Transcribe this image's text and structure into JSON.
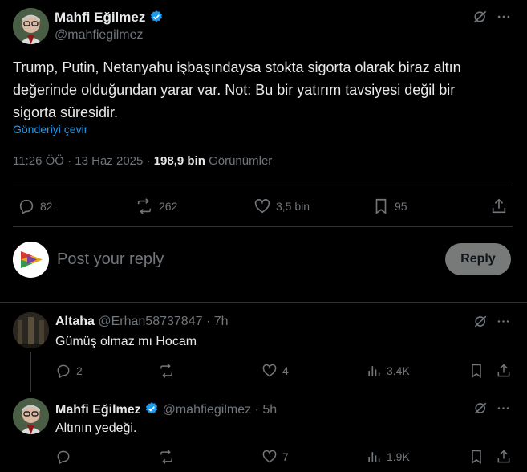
{
  "main_tweet": {
    "author_name": "Mahfi Eğilmez",
    "author_handle": "@mahfiegilmez",
    "text": "Trump, Putin, Netanyahu işbaşındaysa stokta sigorta olarak biraz altın değerinde olduğundan yarar var. Not: Bu bir yatırım tavsiyesi değil bir sigorta süresidir.",
    "translate_label": "Gönderiyi çevir",
    "time": "11:26 ÖÖ",
    "date": "13 Haz 2025",
    "separator": "·",
    "views_count": "198,9 bin",
    "views_label": "Görünümler",
    "stats": {
      "replies": "82",
      "reposts": "262",
      "likes": "3,5 bin",
      "bookmarks": "95"
    }
  },
  "composer": {
    "placeholder": "Post your reply",
    "reply_button": "Reply"
  },
  "replies": [
    {
      "author_name": "Altaha",
      "author_handle": "@Erhan58737847",
      "time": "· 7h",
      "text": "Gümüş olmaz mı Hocam",
      "stats": {
        "replies": "2",
        "reposts": "",
        "likes": "4",
        "views": "3.4K"
      }
    },
    {
      "author_name": "Mahfi Eğilmez",
      "author_handle": "@mahfiegilmez",
      "time": "· 5h",
      "text": "Altının yedeği.",
      "stats": {
        "replies": "",
        "reposts": "",
        "likes": "7",
        "views": "1.9K"
      }
    }
  ],
  "colors": {
    "background": "#000000",
    "text": "#e7e9ea",
    "muted": "#71767b",
    "link": "#1d9bf0",
    "verified": "#1d9bf0",
    "divider": "#2f3336"
  },
  "icons": [
    "grok-icon",
    "more-icon",
    "verified-icon",
    "reply-icon",
    "repost-icon",
    "like-icon",
    "bookmark-icon",
    "share-icon",
    "views-icon"
  ]
}
